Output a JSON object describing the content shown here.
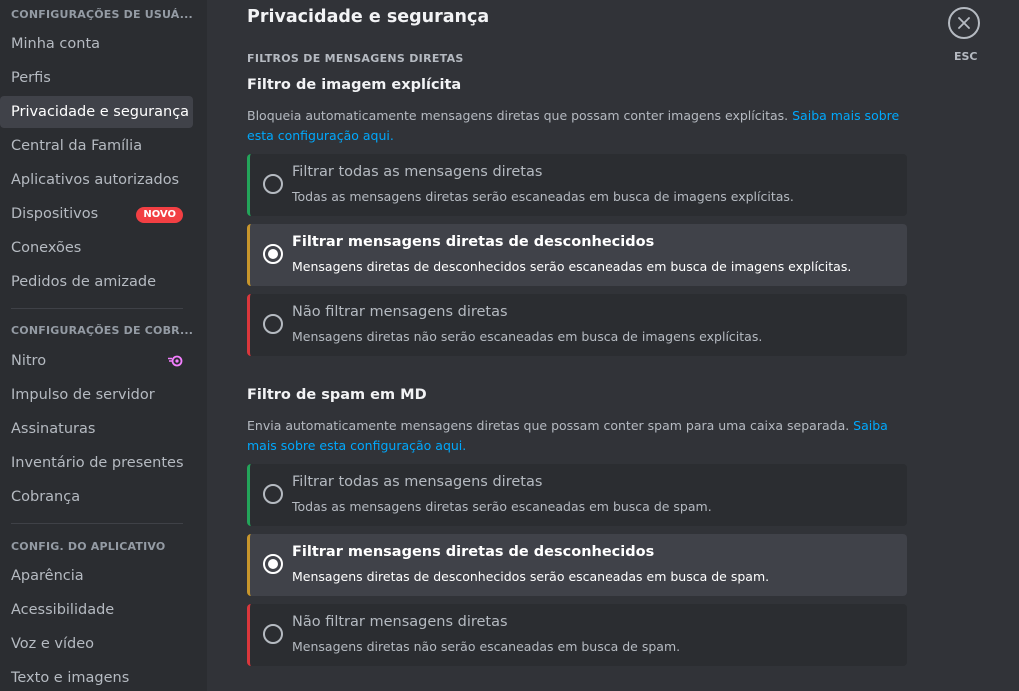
{
  "sidebar": {
    "user_settings_header": "CONFIGURAÇÕES DE USUÁ...",
    "user_items": [
      {
        "label": "Minha conta"
      },
      {
        "label": "Perfis"
      },
      {
        "label": "Privacidade e segurança",
        "selected": true
      },
      {
        "label": "Central da Família"
      },
      {
        "label": "Aplicativos autorizados"
      },
      {
        "label": "Dispositivos",
        "badge": "NOVO"
      },
      {
        "label": "Conexões"
      },
      {
        "label": "Pedidos de amizade"
      }
    ],
    "billing_header": "CONFIGURAÇÕES DE COBR...",
    "billing_items": [
      {
        "label": "Nitro",
        "icon": "nitro-icon"
      },
      {
        "label": "Impulso de servidor"
      },
      {
        "label": "Assinaturas"
      },
      {
        "label": "Inventário de presentes"
      },
      {
        "label": "Cobrança"
      }
    ],
    "app_header": "CONFIG. DO APLICATIVO",
    "app_items": [
      {
        "label": "Aparência"
      },
      {
        "label": "Acessibilidade"
      },
      {
        "label": "Voz e vídeo"
      },
      {
        "label": "Texto e imagens"
      }
    ]
  },
  "main": {
    "title": "Privacidade e segurança",
    "section_header": "FILTROS DE MENSAGENS DIRETAS",
    "explicit": {
      "title": "Filtro de imagem explícita",
      "desc": "Bloqueia automaticamente mensagens diretas que possam conter imagens explícitas. ",
      "link": "Saiba mais sobre esta configuração aqui.",
      "options": [
        {
          "title": "Filtrar todas as mensagens diretas",
          "desc": "Todas as mensagens diretas serão escaneadas em busca de imagens explícitas."
        },
        {
          "title": "Filtrar mensagens diretas de desconhecidos",
          "desc": "Mensagens diretas de desconhecidos serão escaneadas em busca de imagens explícitas."
        },
        {
          "title": "Não filtrar mensagens diretas",
          "desc": "Mensagens diretas não serão escaneadas em busca de imagens explícitas."
        }
      ],
      "selected_index": 1
    },
    "spam": {
      "title": "Filtro de spam em MD",
      "desc": "Envia automaticamente mensagens diretas que possam conter spam para uma caixa separada. ",
      "link": "Saiba mais sobre esta configuração aqui.",
      "options": [
        {
          "title": "Filtrar todas as mensagens diretas",
          "desc": "Todas as mensagens diretas serão escaneadas em busca de spam."
        },
        {
          "title": "Filtrar mensagens diretas de desconhecidos",
          "desc": "Mensagens diretas de desconhecidos serão escaneadas em busca de spam."
        },
        {
          "title": "Não filtrar mensagens diretas",
          "desc": "Mensagens diretas não serão escaneadas em busca de spam."
        }
      ],
      "selected_index": 1
    },
    "close_label": "ESC"
  },
  "colors": {
    "background": "#313338",
    "sidebar": "#2b2d31",
    "selected": "#404249",
    "link": "#00a8fc",
    "green": "#23a55a",
    "yellow": "#c8962c",
    "red": "#da373c",
    "badge": "#f23f43",
    "nitro": "#f47fff"
  }
}
